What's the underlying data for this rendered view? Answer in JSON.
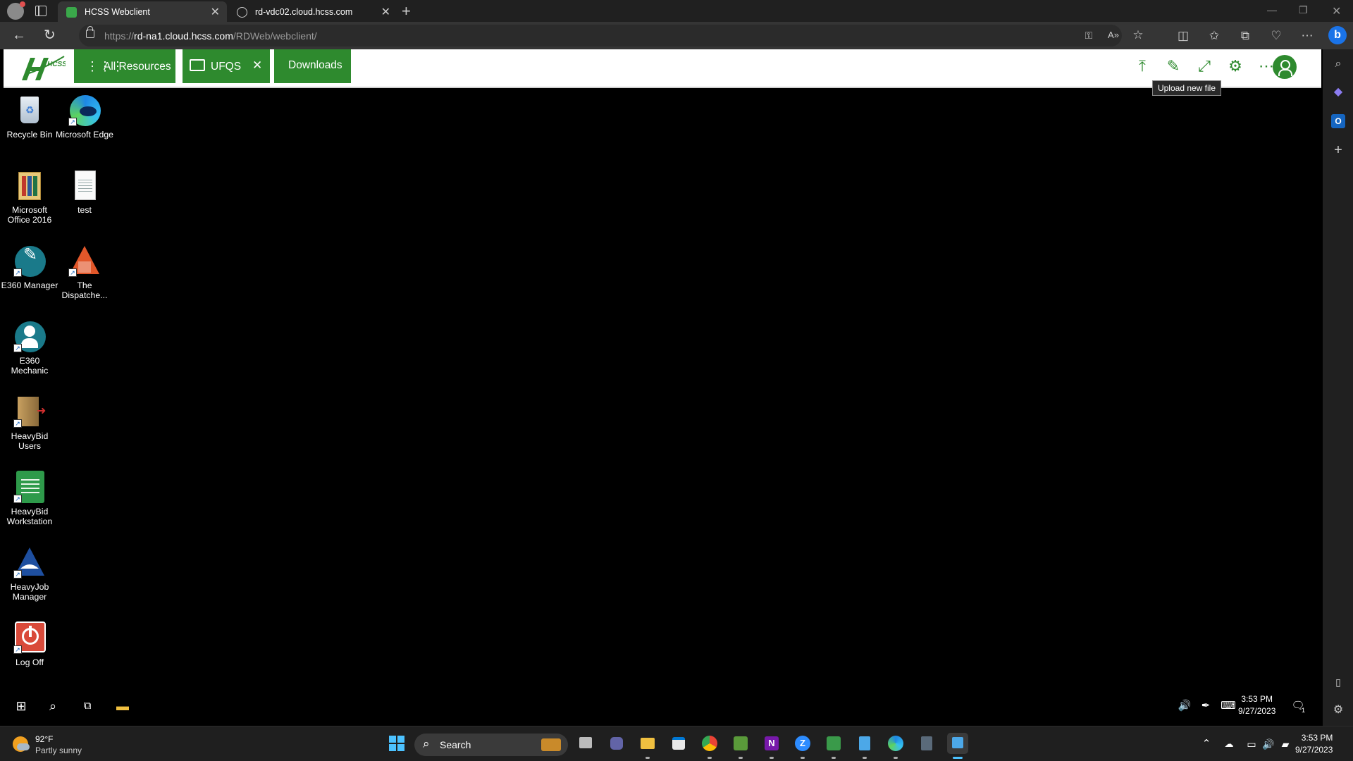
{
  "browser": {
    "tabs": [
      {
        "title": "HCSS Webclient",
        "active": true
      },
      {
        "title": "rd-vdc02.cloud.hcss.com",
        "active": false
      }
    ],
    "url_prefix": "https://",
    "url_host": "rd-na1.cloud.hcss.com",
    "url_path": "/RDWeb/webclient/"
  },
  "webclient": {
    "logo": "HCSS",
    "all_resources_label": "All Resources",
    "session_label": "UFQS",
    "downloads_label": "Downloads",
    "tooltip": "Upload new file"
  },
  "desktop_icons": [
    {
      "label": "Recycle Bin",
      "icon": "recycle-bin-icon"
    },
    {
      "label": "Microsoft Edge",
      "icon": "edge-icon"
    },
    {
      "label": "Microsoft Office 2016",
      "icon": "office-folder-icon"
    },
    {
      "label": "test",
      "icon": "text-file-icon"
    },
    {
      "label": "E360 Manager",
      "icon": "e360-manager-icon"
    },
    {
      "label": "The Dispatche...",
      "icon": "dispatcher-icon"
    },
    {
      "label": "E360 Mechanic",
      "icon": "e360-mechanic-icon"
    },
    {
      "label": "HeavyBid Users",
      "icon": "heavybid-users-icon"
    },
    {
      "label": "HeavyBid Workstation",
      "icon": "heavybid-workstation-icon"
    },
    {
      "label": "HeavyJob Manager",
      "icon": "heavyjob-manager-icon"
    },
    {
      "label": "Log Off",
      "icon": "log-off-icon"
    }
  ],
  "remote_taskbar": {
    "time": "3:53 PM",
    "date": "9/27/2023",
    "notification_count": "1"
  },
  "host_taskbar": {
    "weather_temp": "92°F",
    "weather_desc": "Partly sunny",
    "search_label": "Search",
    "time": "3:53 PM",
    "date": "9/27/2023"
  },
  "colors": {
    "hcss_green": "#2e8a2e",
    "browser_dark": "#202020"
  }
}
